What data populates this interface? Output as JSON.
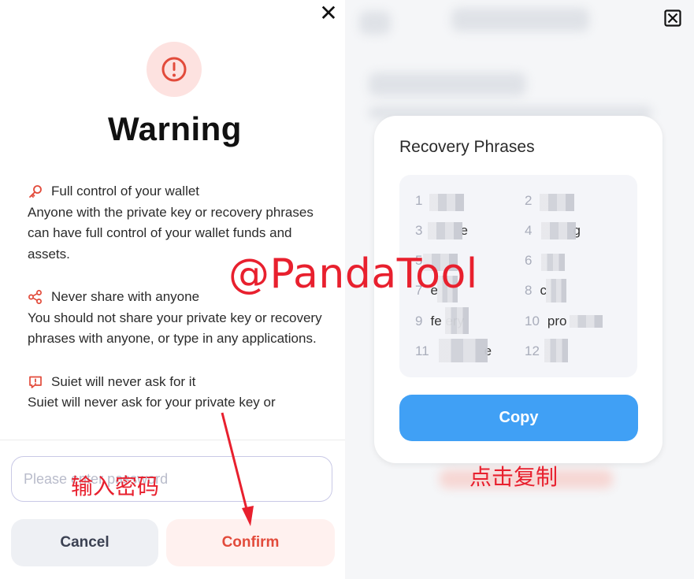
{
  "warning": {
    "title": "Warning",
    "items": [
      {
        "heading": "Full control of your wallet",
        "body": "Anyone with the private key or recovery phrases can have full control of your wallet funds and assets."
      },
      {
        "heading": "Never share with anyone",
        "body": "You should not share your private key or recovery phrases with anyone, or type in any applications."
      },
      {
        "heading": "Suiet will never ask for it",
        "body": "Suiet will never ask for your private key or"
      }
    ],
    "password_placeholder": "Please enter password",
    "cancel_label": "Cancel",
    "confirm_label": "Confirm"
  },
  "recovery": {
    "title": "Recovery Phrases",
    "words": [
      {
        "num": "1",
        "text": ""
      },
      {
        "num": "2",
        "text": ""
      },
      {
        "num": "3",
        "text": "e"
      },
      {
        "num": "4",
        "text": "g"
      },
      {
        "num": "5",
        "text": ""
      },
      {
        "num": "6",
        "text": ""
      },
      {
        "num": "7",
        "text": "e"
      },
      {
        "num": "8",
        "text": "c"
      },
      {
        "num": "9",
        "text": "fe          ery"
      },
      {
        "num": "10",
        "text": "pro"
      },
      {
        "num": "11",
        "text": "e"
      },
      {
        "num": "12",
        "text": ""
      }
    ],
    "copy_label": "Copy"
  },
  "annotations": {
    "watermark": "@PandaTool",
    "enter_password_note": "输入密码",
    "click_copy_note": "点击复制"
  },
  "colors": {
    "accent_red": "#e24b3b",
    "copy_blue": "#40a0f5",
    "annotation_red": "#e8202e"
  }
}
